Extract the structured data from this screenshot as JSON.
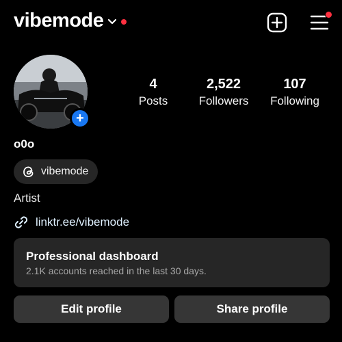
{
  "header": {
    "username": "vibemode",
    "dropdown_icon": "chevron-down-icon",
    "notification_color": "#ff3040",
    "create_icon": "plus-square-icon",
    "menu_icon": "hamburger-menu-icon"
  },
  "profile": {
    "display_name": "o0o",
    "avatar_icon": "profile-photo",
    "add_story_icon": "+",
    "stats": {
      "posts": {
        "value": "4",
        "label": "Posts"
      },
      "followers": {
        "value": "2,522",
        "label": "Followers"
      },
      "following": {
        "value": "107",
        "label": "Following"
      }
    },
    "threads_badge": {
      "icon": "threads-icon",
      "label": "vibemode"
    },
    "category": "Artist",
    "link": {
      "icon": "link-icon",
      "text": "linktr.ee/vibemode"
    }
  },
  "dashboard": {
    "title": "Professional dashboard",
    "subtitle": "2.1K accounts reached in the last 30 days."
  },
  "buttons": {
    "edit": "Edit profile",
    "share": "Share profile"
  },
  "colors": {
    "background": "#000000",
    "surface": "#262626",
    "button": "#363636",
    "accent_blue": "#1877f2"
  }
}
